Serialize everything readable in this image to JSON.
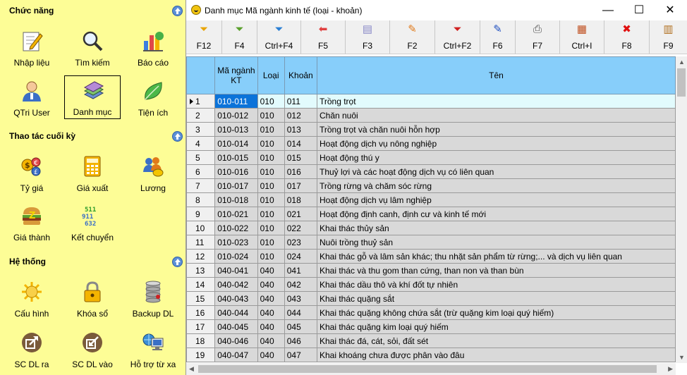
{
  "sidebar": {
    "sections": [
      {
        "title": "Chức năng",
        "items": [
          {
            "label": "Nhập liệu",
            "icon": "pencil-paper-icon"
          },
          {
            "label": "Tìm kiếm",
            "icon": "magnifier-icon"
          },
          {
            "label": "Báo cáo",
            "icon": "chart-report-icon"
          },
          {
            "label": "QTri User",
            "icon": "user-icon"
          },
          {
            "label": "Danh mục",
            "icon": "books-icon",
            "selected": true
          },
          {
            "label": "Tiện ích",
            "icon": "leaf-icon"
          }
        ]
      },
      {
        "title": "Thao tác cuối kỳ",
        "items": [
          {
            "label": "Tỷ giá",
            "icon": "currency-coins-icon"
          },
          {
            "label": "Giá xuất",
            "icon": "calculator-icon"
          },
          {
            "label": "Lương",
            "icon": "people-coin-icon"
          },
          {
            "label": "Giá thành",
            "icon": "burger-icon"
          },
          {
            "label": "Kết chuyển",
            "icon": "binary-transfer-icon"
          }
        ]
      },
      {
        "title": "Hệ thống",
        "items": [
          {
            "label": "Cấu hình",
            "icon": "sun-gear-icon"
          },
          {
            "label": "Khóa sổ",
            "icon": "padlock-icon"
          },
          {
            "label": "Backup DL",
            "icon": "database-icon"
          },
          {
            "label": "SC DL ra",
            "icon": "export-arrow-icon"
          },
          {
            "label": "SC DL vào",
            "icon": "import-arrow-icon"
          },
          {
            "label": "Hỗ trợ từ xa",
            "icon": "remote-support-icon"
          }
        ]
      }
    ]
  },
  "window": {
    "title": "Danh mục Mã ngành kinh tế (loại - khoản)",
    "controls": {
      "minimize": "—",
      "maximize": "☐",
      "close": "✕"
    }
  },
  "toolbar": [
    {
      "label": "F12",
      "icon": "filter-icon",
      "color": "#e8a400"
    },
    {
      "label": "F4",
      "icon": "filter-add-icon",
      "color": "#5aa02c"
    },
    {
      "label": "Ctrl+F4",
      "icon": "filter-blue-icon",
      "color": "#2a7fd4"
    },
    {
      "label": "F5",
      "icon": "back-arrow-icon",
      "color": "#e04040"
    },
    {
      "label": "F3",
      "icon": "document-icon",
      "color": "#8a8ac8"
    },
    {
      "label": "F2",
      "icon": "pencil-icon",
      "color": "#e07a1a"
    },
    {
      "label": "Ctrl+F2",
      "icon": "filter-remove-icon",
      "color": "#d02020"
    },
    {
      "label": "F6",
      "icon": "edit-pen-icon",
      "color": "#2050c0"
    },
    {
      "label": "F7",
      "icon": "printer-icon",
      "color": "#505050"
    },
    {
      "label": "Ctrl+I",
      "icon": "import-grid-icon",
      "color": "#c05020"
    },
    {
      "label": "F8",
      "icon": "delete-x-icon",
      "color": "#e01010"
    },
    {
      "label": "F9",
      "icon": "notebook-icon",
      "color": "#b07020"
    }
  ],
  "grid": {
    "headers": {
      "ma": "Mã ngành KT",
      "loai": "Loại",
      "khoan": "Khoản",
      "ten": "Tên"
    },
    "rows": [
      {
        "n": "1",
        "ma": "010-011",
        "loai": "010",
        "khoan": "011",
        "ten": "Trồng trọt"
      },
      {
        "n": "2",
        "ma": "010-012",
        "loai": "010",
        "khoan": "012",
        "ten": "Chăn nuôi"
      },
      {
        "n": "3",
        "ma": "010-013",
        "loai": "010",
        "khoan": "013",
        "ten": "Trồng trọt và chăn nuôi hỗn hợp"
      },
      {
        "n": "4",
        "ma": "010-014",
        "loai": "010",
        "khoan": "014",
        "ten": "Hoạt động dịch vụ nông nghiệp"
      },
      {
        "n": "5",
        "ma": "010-015",
        "loai": "010",
        "khoan": "015",
        "ten": "Hoạt động thú y"
      },
      {
        "n": "6",
        "ma": "010-016",
        "loai": "010",
        "khoan": "016",
        "ten": "Thuỷ lợi và các hoạt động dịch vụ có liên quan"
      },
      {
        "n": "7",
        "ma": "010-017",
        "loai": "010",
        "khoan": "017",
        "ten": "Trồng rừng và chăm sóc rừng"
      },
      {
        "n": "8",
        "ma": "010-018",
        "loai": "010",
        "khoan": "018",
        "ten": "Hoạt động dịch vụ lâm nghiệp"
      },
      {
        "n": "9",
        "ma": "010-021",
        "loai": "010",
        "khoan": "021",
        "ten": "Hoạt động định canh, định cư và kinh tế mới"
      },
      {
        "n": "10",
        "ma": "010-022",
        "loai": "010",
        "khoan": "022",
        "ten": "Khai thác thủy sản"
      },
      {
        "n": "11",
        "ma": "010-023",
        "loai": "010",
        "khoan": "023",
        "ten": "Nuôi trồng thuỷ sản"
      },
      {
        "n": "12",
        "ma": "010-024",
        "loai": "010",
        "khoan": "024",
        "ten": "Khai thác gỗ và lâm sản khác; thu nhặt sản phẩm từ rừng;... và dịch vụ liên quan"
      },
      {
        "n": "13",
        "ma": "040-041",
        "loai": "040",
        "khoan": "041",
        "ten": "Khai thác và thu gom than cứng, than non và than bùn"
      },
      {
        "n": "14",
        "ma": "040-042",
        "loai": "040",
        "khoan": "042",
        "ten": "Khai thác dầu thô và khí đốt tự nhiên"
      },
      {
        "n": "15",
        "ma": "040-043",
        "loai": "040",
        "khoan": "043",
        "ten": "Khai thác quặng sắt"
      },
      {
        "n": "16",
        "ma": "040-044",
        "loai": "040",
        "khoan": "044",
        "ten": "Khai thác quặng không chứa sắt (trừ quặng kim loại quý hiếm)"
      },
      {
        "n": "17",
        "ma": "040-045",
        "loai": "040",
        "khoan": "045",
        "ten": "Khai thác quặng kim loại quý hiếm"
      },
      {
        "n": "18",
        "ma": "040-046",
        "loai": "040",
        "khoan": "046",
        "ten": "Khai thác đá, cát, sỏi, đất sét"
      },
      {
        "n": "19",
        "ma": "040-047",
        "loai": "040",
        "khoan": "047",
        "ten": "Khai khoáng chưa được phân vào đâu"
      }
    ]
  }
}
